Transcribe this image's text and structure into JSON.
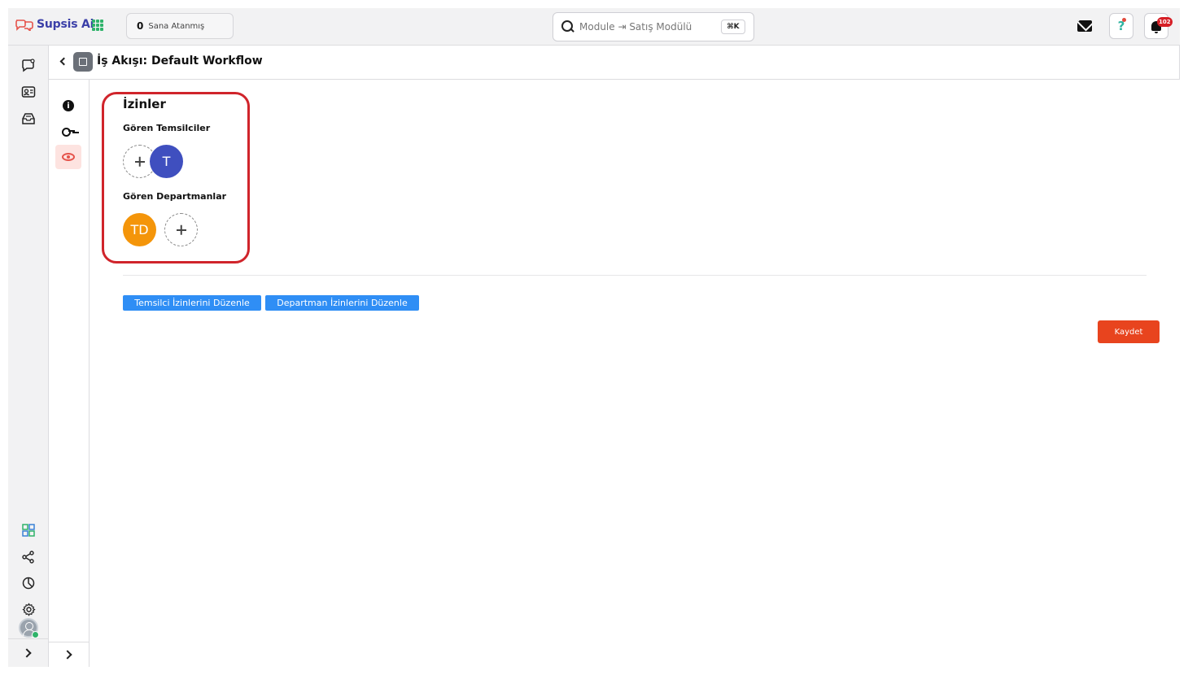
{
  "app": {
    "name": "Supsis Ai"
  },
  "topbar": {
    "assigned_count": "0",
    "assigned_label": "Sana Atanmış",
    "search_text": "Module ⇥ Satış Modülü",
    "search_shortcut": "⌘K",
    "help_label": "?",
    "notification_count": "102"
  },
  "header": {
    "title": "İş Akışı: Default Workflow"
  },
  "permissions": {
    "title": "İzinler",
    "viewing_reps_label": "Gören Temsilciler",
    "rep_avatar": "T",
    "viewing_depts_label": "Gören Departmanlar",
    "dept_avatar": "TD"
  },
  "actions": {
    "edit_rep_perms": "Temsilci İzinlerini Düzenle",
    "edit_dept_perms": "Departman İzinlerini Düzenle",
    "save": "Kaydet"
  },
  "colors": {
    "brand": "#3b3fa8",
    "rep_avatar": "#3f4fbf",
    "dept_avatar": "#f4950a",
    "primary_button": "#2f8ef5",
    "save_button": "#e8441e",
    "highlight": "#d0242b"
  }
}
